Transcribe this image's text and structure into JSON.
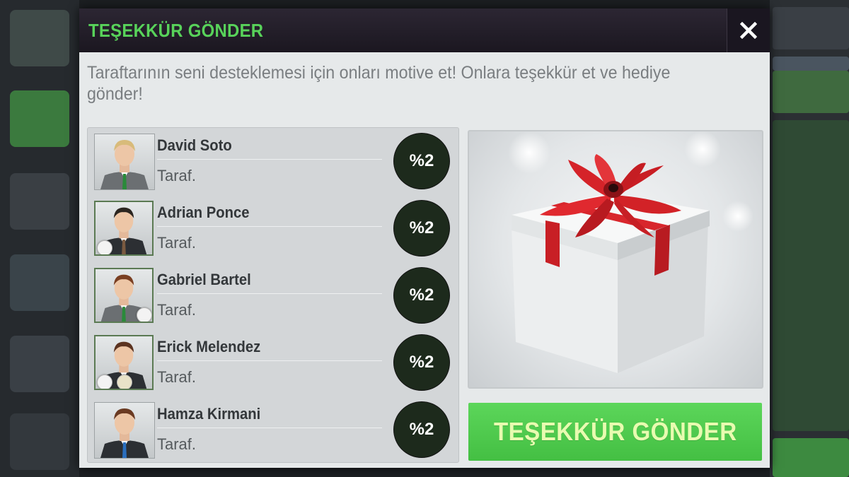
{
  "dialog": {
    "title": "TEŞEKKÜR GÖNDER",
    "close_icon": "close-icon",
    "description": "Taraftarının seni desteklemesi için onları motive et! Onlara teşekkür et ve hediye gönder!",
    "send_button_label": "TEŞEKKÜR GÖNDER"
  },
  "fans": [
    {
      "name": "David Soto",
      "role": "Taraf.",
      "percent": "%2",
      "hair": "#d8bb7a",
      "tie": "#2a8a3a"
    },
    {
      "name": "Adrian Ponce",
      "role": "Taraf.",
      "percent": "%2",
      "hair": "#2b2520",
      "tie": "#7a5a40"
    },
    {
      "name": "Gabriel Bartel",
      "role": "Taraf.",
      "percent": "%2",
      "hair": "#7a3f22",
      "tie": "#2a8a3a"
    },
    {
      "name": "Erick Melendez",
      "role": "Taraf.",
      "percent": "%2",
      "hair": "#5b3320",
      "tie": "#d8dbdd"
    },
    {
      "name": "Hamza Kirmani",
      "role": "Taraf.",
      "percent": "%2",
      "hair": "#6a3a22",
      "tie": "#2b6fbf"
    }
  ],
  "colors": {
    "accent_green": "#58d35a",
    "button_green": "#4cc84a",
    "button_text": "#e8fbb0",
    "percent_badge": "#1d2a1c"
  }
}
